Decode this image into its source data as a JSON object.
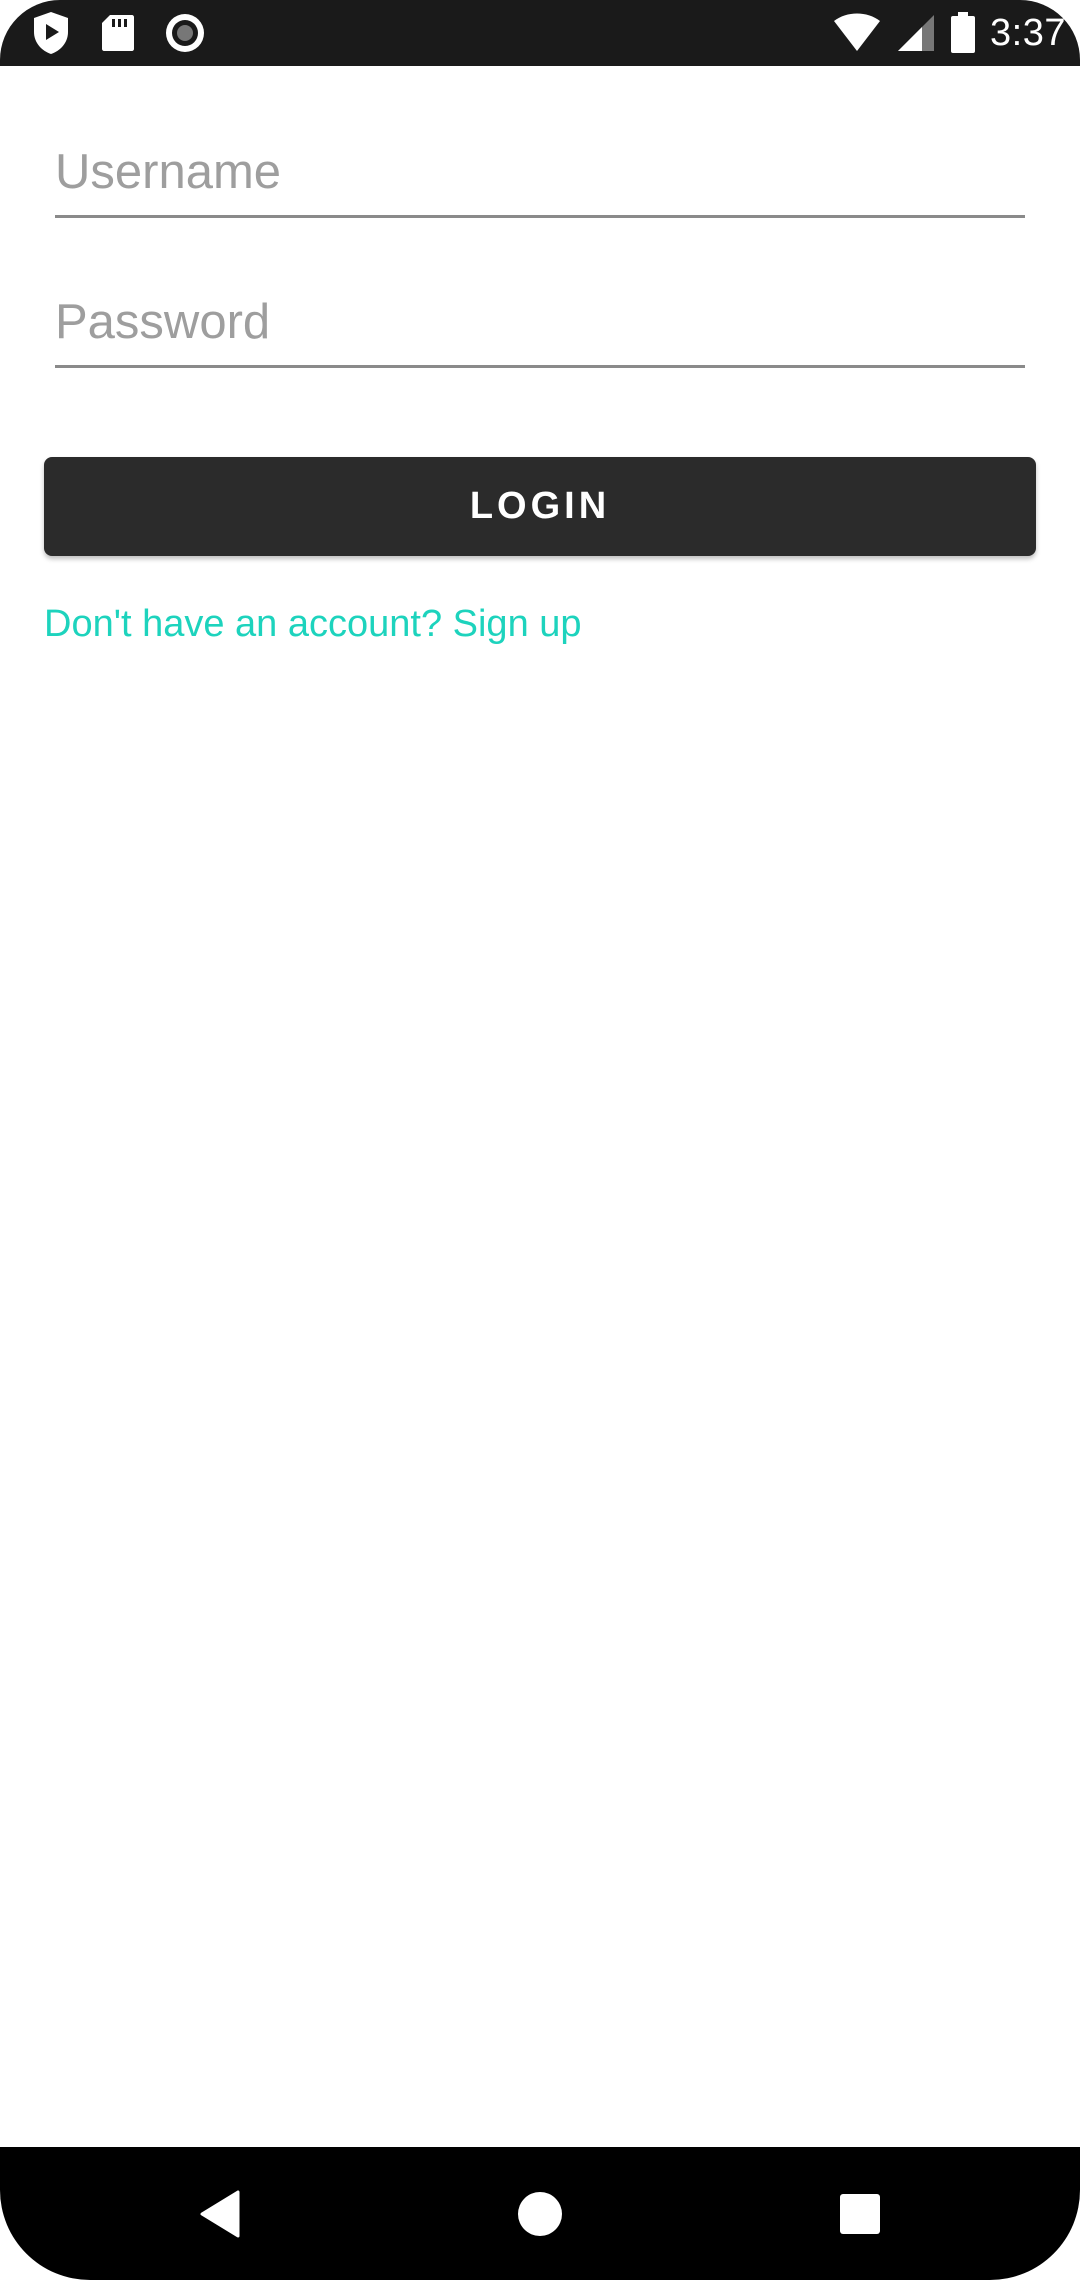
{
  "status_bar": {
    "time": "3:37",
    "icons": [
      "shield-play-icon",
      "sd-card-icon",
      "record-icon",
      "wifi-icon",
      "signal-icon",
      "battery-icon"
    ]
  },
  "login_form": {
    "username_placeholder": "Username",
    "username_value": "",
    "password_placeholder": "Password",
    "password_value": "",
    "login_label": "LOGIN",
    "signup_text": "Don't have an account? Sign up"
  },
  "nav_bar": {
    "icons": [
      "back-icon",
      "home-icon",
      "recents-icon"
    ]
  },
  "colors": {
    "status_bar_bg": "#1a1a1a",
    "button_bg": "#2b2b2b",
    "link_accent": "#1dd3bd",
    "underline": "#8a8a8a",
    "placeholder": "#9e9e9e"
  }
}
